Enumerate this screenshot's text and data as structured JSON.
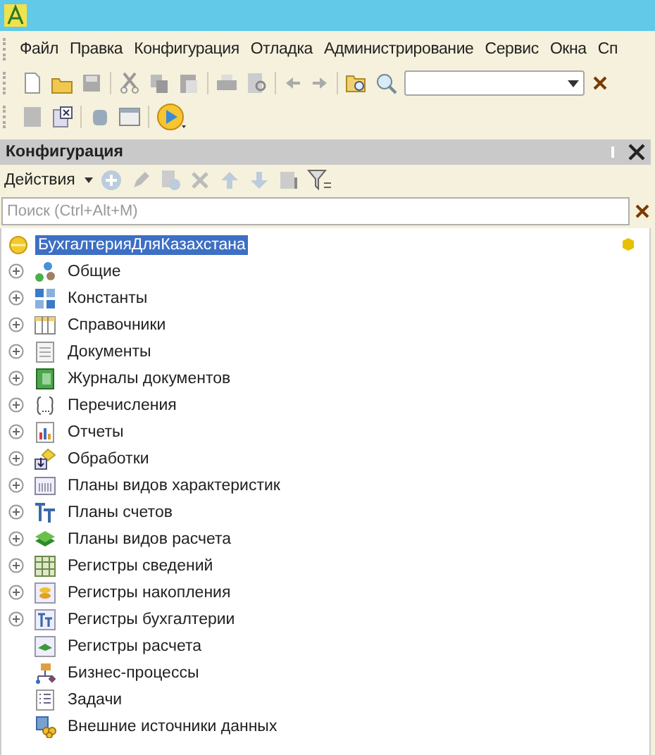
{
  "menu": [
    "Файл",
    "Правка",
    "Конфигурация",
    "Отладка",
    "Администрирование",
    "Сервис",
    "Окна",
    "Сп"
  ],
  "panel": {
    "title": "Конфигурация",
    "actions_label": "Действия",
    "search": {
      "placeholder": "Поиск (Ctrl+Alt+M)"
    }
  },
  "tree": {
    "root": {
      "name": "БухгалтерияДляКазахстана",
      "selected": true
    },
    "children": [
      {
        "name": "Общие",
        "expandable": true,
        "kind": "common"
      },
      {
        "name": "Константы",
        "expandable": true,
        "kind": "constants"
      },
      {
        "name": "Справочники",
        "expandable": true,
        "kind": "catalogs"
      },
      {
        "name": "Документы",
        "expandable": true,
        "kind": "documents"
      },
      {
        "name": "Журналы документов",
        "expandable": true,
        "kind": "journals"
      },
      {
        "name": "Перечисления",
        "expandable": true,
        "kind": "enums"
      },
      {
        "name": "Отчеты",
        "expandable": true,
        "kind": "reports"
      },
      {
        "name": "Обработки",
        "expandable": true,
        "kind": "processors"
      },
      {
        "name": "Планы видов характеристик",
        "expandable": true,
        "kind": "characteristics"
      },
      {
        "name": "Планы счетов",
        "expandable": true,
        "kind": "accounts"
      },
      {
        "name": "Планы видов расчета",
        "expandable": true,
        "kind": "calctypes"
      },
      {
        "name": "Регистры сведений",
        "expandable": true,
        "kind": "inforeg"
      },
      {
        "name": "Регистры накопления",
        "expandable": true,
        "kind": "accumreg"
      },
      {
        "name": "Регистры бухгалтерии",
        "expandable": true,
        "kind": "accountingreg"
      },
      {
        "name": "Регистры расчета",
        "expandable": false,
        "kind": "calcreg"
      },
      {
        "name": "Бизнес-процессы",
        "expandable": false,
        "kind": "processes"
      },
      {
        "name": "Задачи",
        "expandable": false,
        "kind": "tasks"
      },
      {
        "name": "Внешние источники данных",
        "expandable": false,
        "kind": "external"
      }
    ]
  }
}
